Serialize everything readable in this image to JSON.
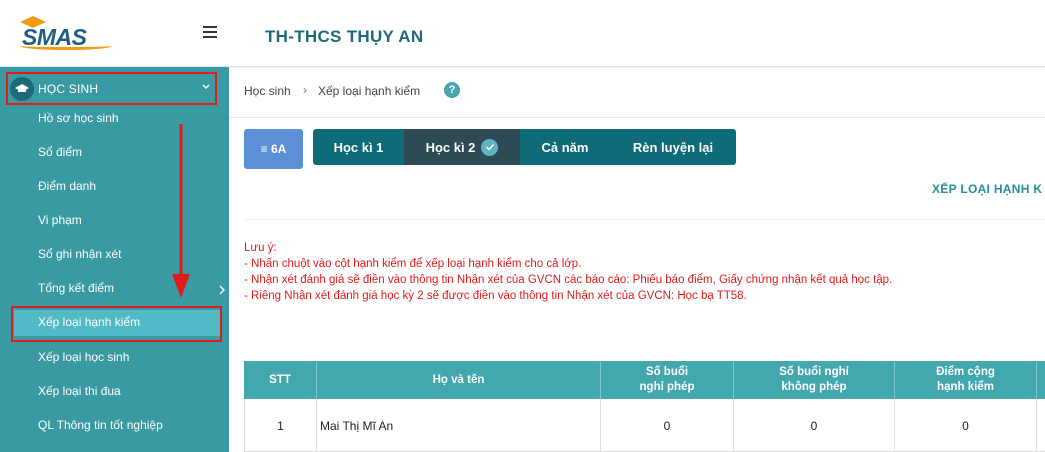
{
  "sidebar": {
    "logo_text": "SMAS",
    "menu_header": "HỌC SINH",
    "items": [
      {
        "label": "Hồ sơ học sinh"
      },
      {
        "label": "Sổ điểm"
      },
      {
        "label": "Điểm danh"
      },
      {
        "label": "Vi phạm"
      },
      {
        "label": "Sổ ghi nhận xét"
      },
      {
        "label": "Tổng kết điểm"
      },
      {
        "label": "Xếp loại hạnh kiểm"
      },
      {
        "label": "Xếp loại học sinh"
      },
      {
        "label": "Xếp loại thi đua"
      },
      {
        "label": "QL Thông tin tốt nghiệp"
      }
    ],
    "active_item": "Xếp loại hạnh kiểm"
  },
  "header": {
    "school_name": "TH-THCS THỤY AN"
  },
  "breadcrumb": {
    "items": [
      "Học sinh",
      "Xếp loại hạnh kiểm"
    ],
    "separator": "›",
    "help": "?"
  },
  "toolbar": {
    "class_button": "≡ 6A",
    "tabs": [
      {
        "label": "Học kì 1",
        "active": false
      },
      {
        "label": "Học kì 2",
        "active": true
      },
      {
        "label": "Cả năm",
        "active": false
      },
      {
        "label": "Rèn luyện lại",
        "active": false
      }
    ]
  },
  "section_title": "XẾP LOẠI HẠNH K",
  "notes": {
    "title": "Lưu ý:",
    "lines": [
      "- Nhấn chuột vào cột hạnh kiểm để xếp loại hạnh kiểm cho cả lớp.",
      "- Nhận xét đánh giá sẽ điền vào thông tin Nhận xét của GVCN các báo cáo: Phiếu báo điểm, Giấy chứng nhận kết quả học tập.",
      "- Riêng Nhận xét đánh giá học kỳ 2 sẽ được điền vào thông tin Nhận xét của GVCN: Học bạ TT58."
    ]
  },
  "table": {
    "headers": [
      "STT",
      "Họ và tên",
      "Số buổi\nnghỉ phép",
      "Số buổi nghỉ\nkhông phép",
      "Điểm cộng\nhạnh kiểm"
    ],
    "rows": [
      [
        "1",
        "Mai Thị Mĩ An",
        "0",
        "0",
        "0"
      ]
    ]
  },
  "colors": {
    "sidebar_bg": "#3a9aa3",
    "tab_bg": "#0e6b78",
    "tab_active_bg": "#2d4a55",
    "table_header_bg": "#43a7ae",
    "note_red": "#e01b1b",
    "highlight_box": "#e01b1b"
  }
}
